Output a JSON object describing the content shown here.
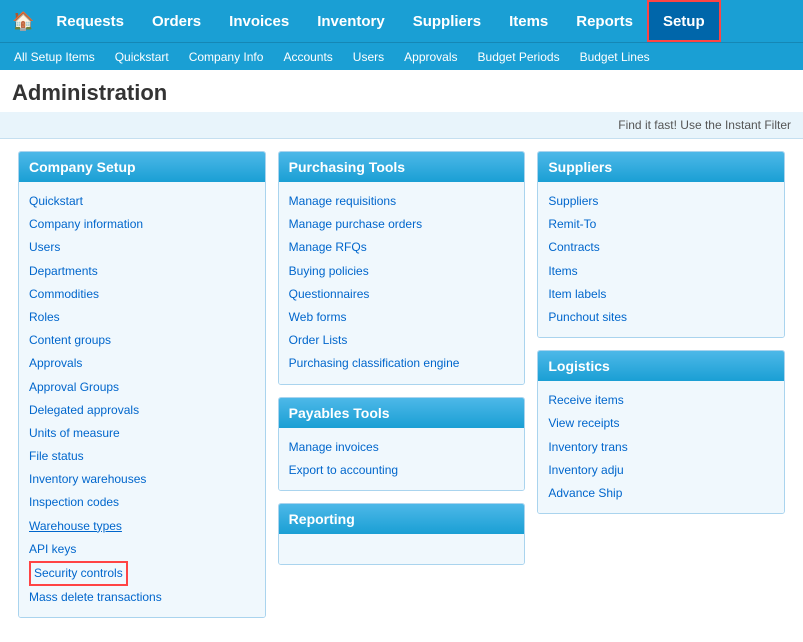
{
  "topNav": {
    "home_icon": "🏠",
    "items": [
      {
        "label": "Requests",
        "href": "#",
        "active": false
      },
      {
        "label": "Orders",
        "href": "#",
        "active": false
      },
      {
        "label": "Invoices",
        "href": "#",
        "active": false
      },
      {
        "label": "Inventory",
        "href": "#",
        "active": false
      },
      {
        "label": "Suppliers",
        "href": "#",
        "active": false
      },
      {
        "label": "Items",
        "href": "#",
        "active": false
      },
      {
        "label": "Reports",
        "href": "#",
        "active": false
      },
      {
        "label": "Setup",
        "href": "#",
        "active": true
      }
    ]
  },
  "subNav": {
    "items": [
      {
        "label": "All Setup Items"
      },
      {
        "label": "Quickstart"
      },
      {
        "label": "Company Info"
      },
      {
        "label": "Accounts"
      },
      {
        "label": "Users"
      },
      {
        "label": "Approvals"
      },
      {
        "label": "Budget Periods"
      },
      {
        "label": "Budget Lines"
      }
    ]
  },
  "pageTitle": "Administration",
  "filterBar": "Find it fast! Use the Instant Filter",
  "columns": [
    {
      "id": "company-setup",
      "sections": [
        {
          "title": "Company Setup",
          "links": [
            "Quickstart",
            "Company information",
            "Users",
            "Departments",
            "Commodities",
            "Roles",
            "Content groups",
            "Approvals",
            "Approval Groups",
            "Delegated approvals",
            "Units of measure",
            "File status",
            "Inventory warehouses",
            "Inspection codes",
            "Warehouse types",
            "API keys",
            "Security controls",
            "Mass delete transactions"
          ],
          "underlined": [
            "Warehouse types"
          ],
          "highlighted": [
            "Security controls"
          ]
        }
      ]
    },
    {
      "id": "purchasing-payables",
      "sections": [
        {
          "title": "Purchasing Tools",
          "links": [
            "Manage requisitions",
            "Manage purchase orders",
            "Manage RFQs",
            "Buying policies",
            "Questionnaires",
            "Web forms",
            "Order Lists",
            "Purchasing classification engine"
          ]
        },
        {
          "title": "Payables Tools",
          "links": [
            "Manage invoices",
            "Export to accounting"
          ]
        },
        {
          "title": "Reporting",
          "links": []
        }
      ]
    },
    {
      "id": "suppliers-logistics",
      "sections": [
        {
          "title": "Suppliers",
          "links": [
            "Suppliers",
            "Remit-To",
            "Contracts",
            "Items",
            "Item labels",
            "Punchout sites"
          ]
        },
        {
          "title": "Logistics",
          "links": [
            "Receive items",
            "View receipts",
            "Inventory trans",
            "Inventory adju",
            "Advance Ship"
          ]
        }
      ]
    }
  ]
}
